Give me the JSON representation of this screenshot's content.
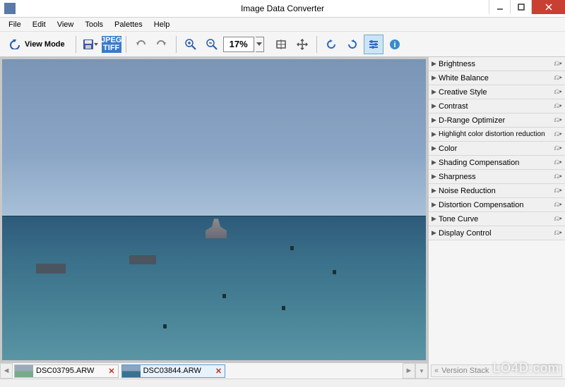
{
  "window": {
    "title": "Image Data Converter",
    "minimize": "Minimize",
    "maximize": "Maximize",
    "close": "Close"
  },
  "menu": {
    "file": "File",
    "edit": "Edit",
    "view": "View",
    "tools": "Tools",
    "palettes": "Palettes",
    "help": "Help"
  },
  "toolbar": {
    "view_mode": "View Mode",
    "save_badge_top": "JPEG",
    "save_badge_bottom": "TIFF",
    "zoom_value": "17%"
  },
  "panels": [
    {
      "label": "Brightness"
    },
    {
      "label": "White Balance"
    },
    {
      "label": "Creative Style"
    },
    {
      "label": "Contrast"
    },
    {
      "label": "D-Range Optimizer"
    },
    {
      "label": "Highlight color distortion reduction"
    },
    {
      "label": "Color"
    },
    {
      "label": "Shading Compensation"
    },
    {
      "label": "Sharpness"
    },
    {
      "label": "Noise Reduction"
    },
    {
      "label": "Distortion Compensation"
    },
    {
      "label": "Tone Curve"
    },
    {
      "label": "Display Control"
    }
  ],
  "thumbnails": [
    {
      "filename": "DSC03795.ARW",
      "active": false
    },
    {
      "filename": "DSC03844.ARW",
      "active": true
    }
  ],
  "version_stack": {
    "label": "Version Stack"
  },
  "watermark": "LO4D.com"
}
